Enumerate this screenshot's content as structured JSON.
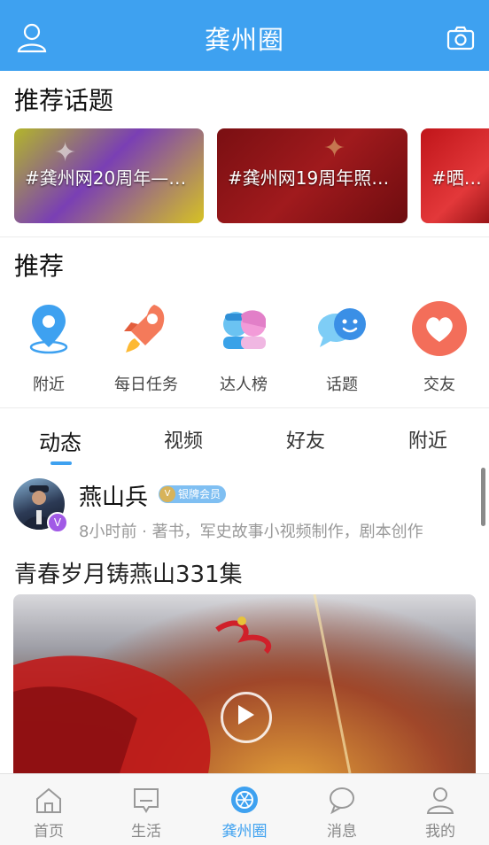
{
  "header": {
    "title": "龚州圈",
    "left_icon": "user-icon",
    "right_icon": "camera-icon"
  },
  "topics_section": {
    "title": "推荐话题",
    "items": [
      {
        "label": "#龚州网20周年——#..."
      },
      {
        "label": "#龚州网19周年照片..."
      },
      {
        "label": "#晒你身"
      }
    ]
  },
  "recommend_section": {
    "title": "推荐",
    "items": [
      {
        "label": "附近",
        "icon": "location-pin-icon"
      },
      {
        "label": "每日任务",
        "icon": "rocket-icon"
      },
      {
        "label": "达人榜",
        "icon": "people-icon"
      },
      {
        "label": "话题",
        "icon": "chat-bubbles-icon"
      },
      {
        "label": "交友",
        "icon": "heart-icon"
      }
    ]
  },
  "tabs": [
    {
      "label": "动态",
      "active": true
    },
    {
      "label": "视频",
      "active": false
    },
    {
      "label": "好友",
      "active": false
    },
    {
      "label": "附近",
      "active": false
    }
  ],
  "post": {
    "username": "燕山兵",
    "member_badge": "银牌会员",
    "meta": "8小时前 · 著书，军史故事小视频制作，剧本创作",
    "title": "青春岁月铸燕山331集"
  },
  "bottom_nav": [
    {
      "label": "首页",
      "icon": "home-icon",
      "active": false
    },
    {
      "label": "生活",
      "icon": "message-board-icon",
      "active": false
    },
    {
      "label": "龚州圈",
      "icon": "circle-icon",
      "active": true
    },
    {
      "label": "消息",
      "icon": "chat-icon",
      "active": false
    },
    {
      "label": "我的",
      "icon": "profile-icon",
      "active": false
    }
  ],
  "colors": {
    "primary": "#3ea1f0",
    "nav_inactive": "#888888"
  }
}
